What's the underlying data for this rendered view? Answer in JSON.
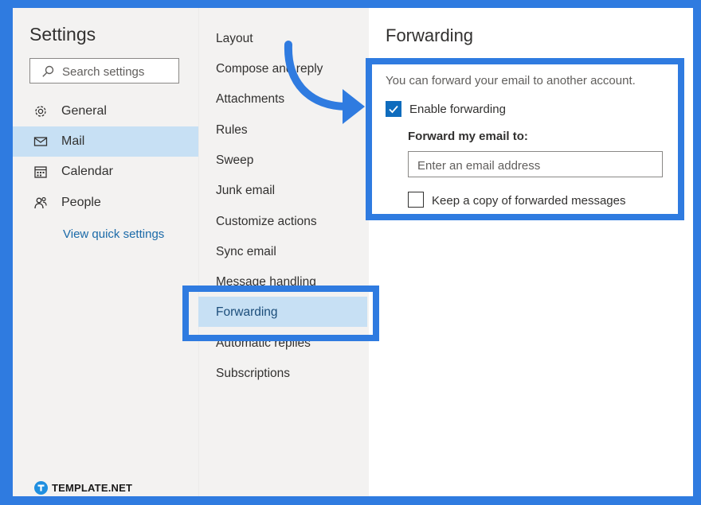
{
  "settings": {
    "title": "Settings",
    "search_placeholder": "Search settings",
    "categories": [
      {
        "label": "General",
        "icon": "gear-icon"
      },
      {
        "label": "Mail",
        "icon": "mail-icon",
        "selected": true
      },
      {
        "label": "Calendar",
        "icon": "calendar-icon"
      },
      {
        "label": "People",
        "icon": "people-icon"
      }
    ],
    "quick_link": "View quick settings"
  },
  "mail_menu": {
    "items": [
      "Layout",
      "Compose and reply",
      "Attachments",
      "Rules",
      "Sweep",
      "Junk email",
      "Customize actions",
      "Sync email",
      "Message handling",
      "Forwarding",
      "Automatic replies",
      "Subscriptions"
    ],
    "selected": "Forwarding"
  },
  "forwarding": {
    "title": "Forwarding",
    "description": "You can forward your email to another account.",
    "enable_label": "Enable forwarding",
    "enable_checked": true,
    "address_label": "Forward my email to:",
    "address_placeholder": "Enter an email address",
    "keep_copy_label": "Keep a copy of forwarded messages",
    "keep_copy_checked": false
  },
  "branding": {
    "logo_text": "TEMPLATE.NET"
  },
  "colors": {
    "frame": "#2f7be0",
    "selection": "#c7e0f4",
    "accent": "#0f6cbd",
    "link": "#1b6aa8"
  }
}
